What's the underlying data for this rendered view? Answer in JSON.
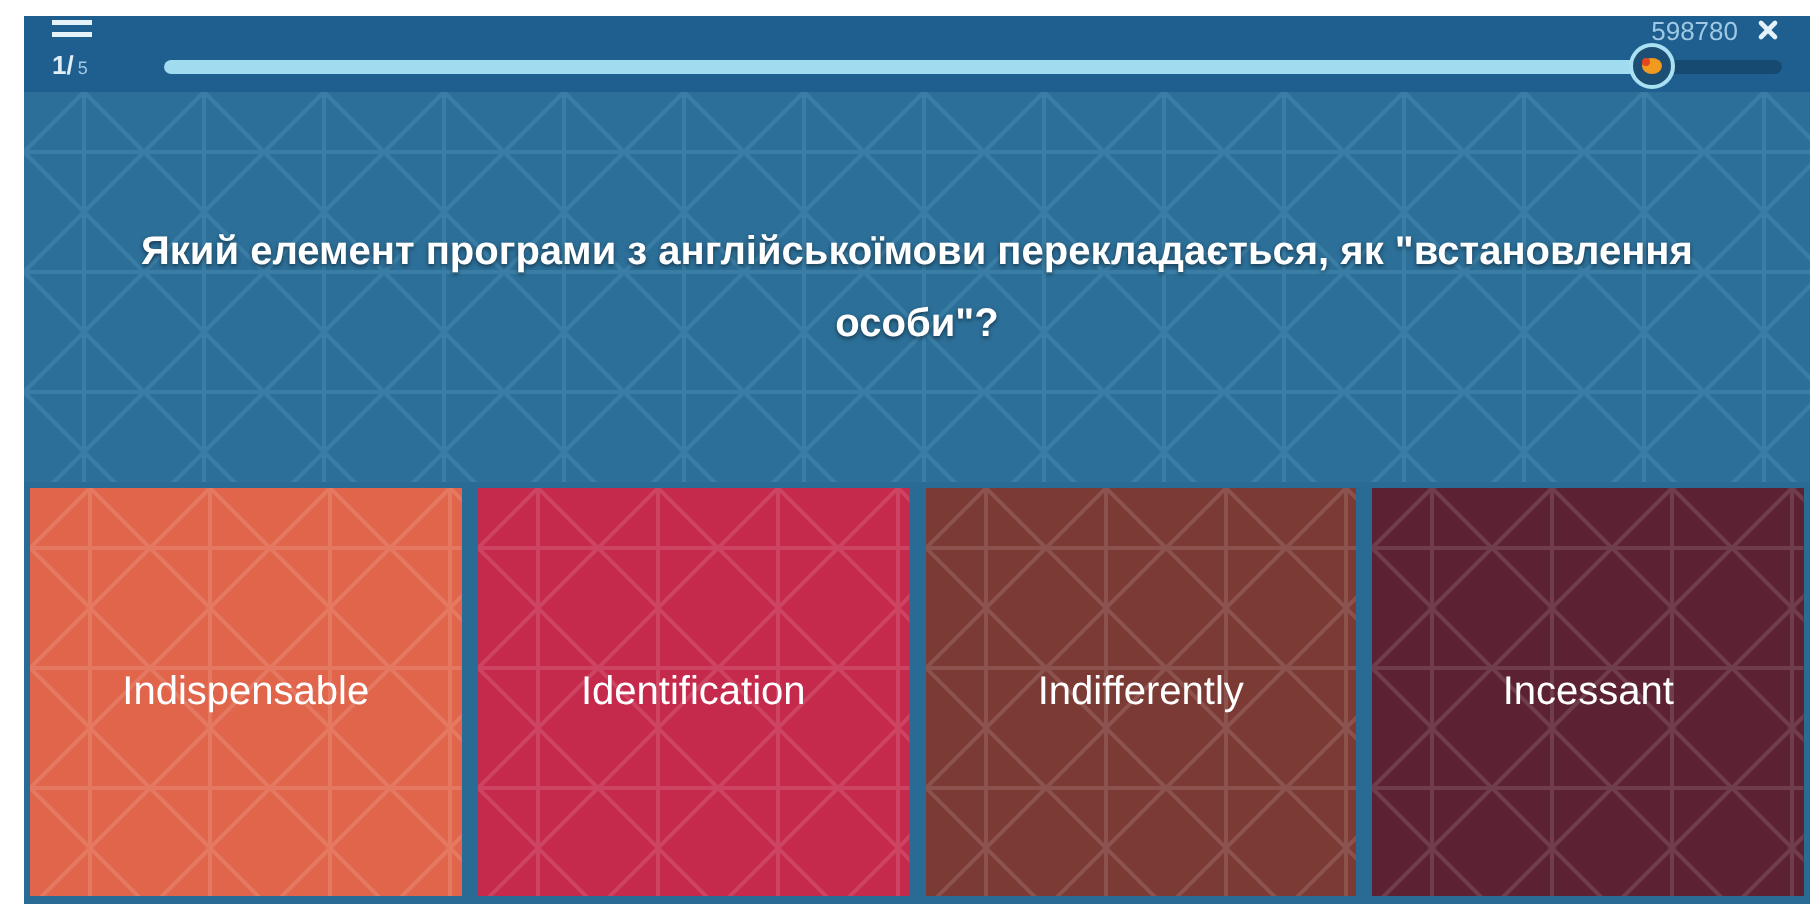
{
  "progress": {
    "current": "1/",
    "total": "5",
    "level": 0.92
  },
  "score": "598780",
  "question": "Який елемент програми з англійськоїмови перекладається, як \"встановлення особи\"?",
  "answers": [
    {
      "label": "Indispensable",
      "color": "#e0654b"
    },
    {
      "label": "Identification",
      "color": "#c52a4c"
    },
    {
      "label": "Indifferently",
      "color": "#7c3a35"
    },
    {
      "label": "Incessant",
      "color": "#5c2233"
    }
  ]
}
